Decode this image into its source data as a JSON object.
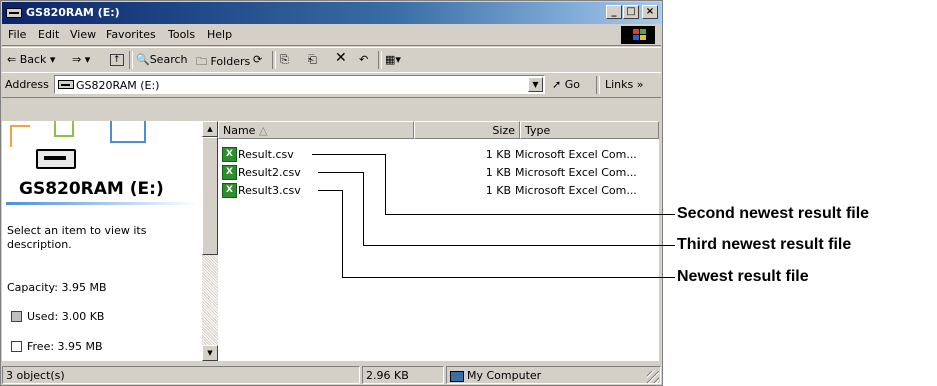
{
  "window": {
    "title": "GS820RAM (E:)",
    "buttons": {
      "minimize": "_",
      "maximize": "□",
      "close": "×"
    }
  },
  "menubar": {
    "items": [
      "File",
      "Edit",
      "View",
      "Favorites",
      "Tools",
      "Help"
    ]
  },
  "toolbar": {
    "back": "Back",
    "search": "Search",
    "folders": "Folders",
    "views_icon": "views-icon"
  },
  "address": {
    "label": "Address",
    "value": "GS820RAM (E:)",
    "go": "Go",
    "links": "Links"
  },
  "left_pane": {
    "drive_title": "GS820RAM (E:)",
    "description": "Select an item to view its description.",
    "capacity": "Capacity: 3.95 MB",
    "used": "Used: 3.00 KB",
    "free": "Free: 3.95 MB"
  },
  "file_list": {
    "columns": [
      "Name",
      "Size",
      "Type"
    ],
    "rows": [
      {
        "name": "Result.csv",
        "size": "1 KB",
        "type": "Microsoft Excel Com..."
      },
      {
        "name": "Result2.csv",
        "size": "1 KB",
        "type": "Microsoft Excel Com..."
      },
      {
        "name": "Result3.csv",
        "size": "1 KB",
        "type": "Microsoft Excel Com..."
      }
    ]
  },
  "status": {
    "objects": "3 object(s)",
    "size": "2.96 KB",
    "zone": "My Computer"
  },
  "callouts": {
    "second": "Second newest result file",
    "third": "Third newest result file",
    "newest": "Newest result file"
  },
  "colors": {
    "titlebar": "#0a246a",
    "chrome": "#d4d0c8",
    "excel_icon": "#2f8f2f"
  }
}
